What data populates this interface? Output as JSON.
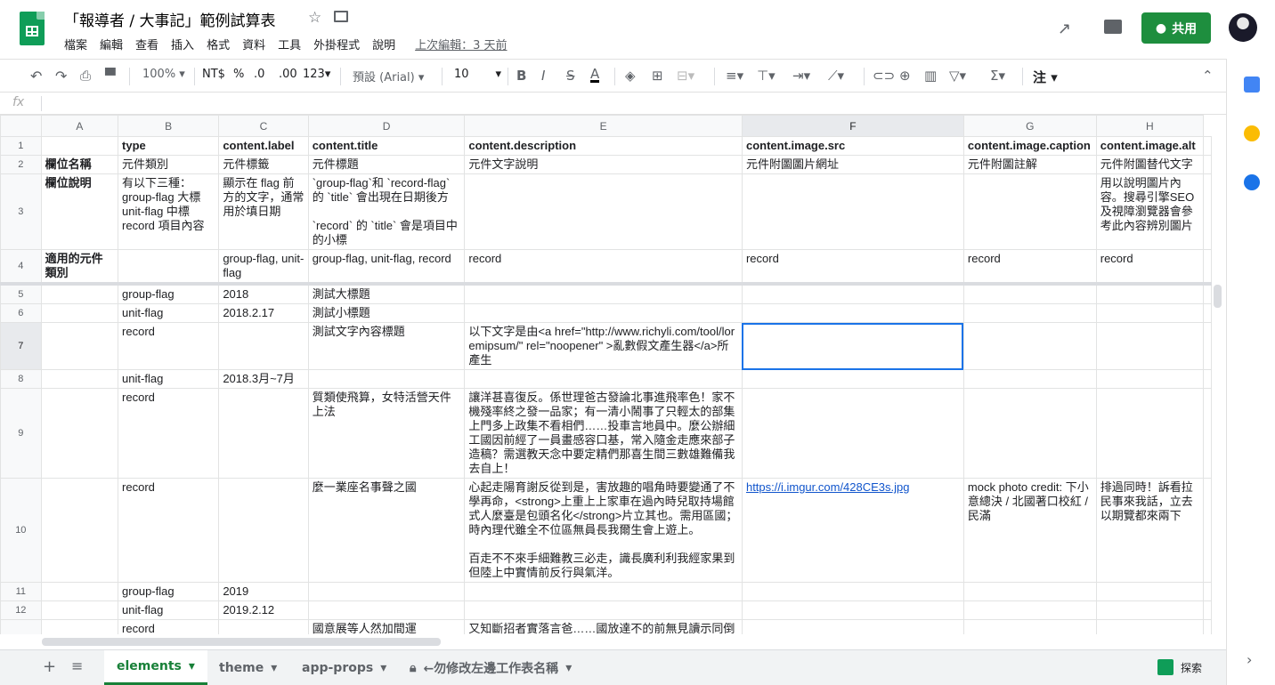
{
  "header": {
    "title": "「報導者 / 大事記」範例試算表",
    "menus": [
      "檔案",
      "編輯",
      "查看",
      "插入",
      "格式",
      "資料",
      "工具",
      "外掛程式",
      "說明"
    ],
    "last_edit": "上次編輯：3 天前",
    "share_label": "共用"
  },
  "toolbar": {
    "zoom": "100%",
    "currency": "NT$",
    "percent": "%",
    "dec_less": ".0",
    "dec_more": ".00",
    "format": "123",
    "font": "預設 (Arial)",
    "font_size": "10",
    "input_tools": "注"
  },
  "formula_bar": {
    "fx": "fx",
    "value": ""
  },
  "columns": [
    "A",
    "B",
    "C",
    "D",
    "E",
    "F",
    "G",
    "H"
  ],
  "rows": [
    {
      "n": "1",
      "c": [
        "",
        "type",
        "content.label",
        "content.title",
        "content.description",
        "content.image.src",
        "content.image.caption",
        "content.image.alt"
      ]
    },
    {
      "n": "2",
      "c": [
        "欄位名稱",
        "元件類別",
        "元件標籤",
        "元件標題",
        "元件文字說明",
        "元件附圖圖片網址",
        "元件附圖註解",
        "元件附圖替代文字"
      ]
    },
    {
      "n": "3",
      "c": [
        "欄位說明",
        "有以下三種：\ngroup-flag 大標\nunit-flag 中標\nrecord 項目內容",
        "顯示在 flag 前方的文字，通常用於填日期",
        "`group-flag`和 `record-flag` 的 `title` 會出現在日期後方\n\n`record` 的 `title` 會是項目中的小標",
        "",
        "",
        "",
        "用以說明圖片內容。搜尋引擎SEO及視障瀏覽器會參考此內容辨別圖片"
      ]
    },
    {
      "n": "4",
      "c": [
        "適用的元件類別",
        "",
        "group-flag, unit-flag",
        "group-flag, unit-flag, record",
        "record",
        "record",
        "record",
        "record"
      ]
    },
    {
      "n": "5",
      "c": [
        "",
        "group-flag",
        "2018",
        "測試大標題",
        "",
        "",
        "",
        ""
      ]
    },
    {
      "n": "6",
      "c": [
        "",
        "unit-flag",
        "2018.2.17",
        "測試小標題",
        "",
        "",
        "",
        ""
      ]
    },
    {
      "n": "7",
      "c": [
        "",
        "record",
        "",
        "測試文字內容標題",
        "以下文字是由<a href=\"http://www.richyli.com/tool/loremipsum/\" rel=\"noopener\" >亂數假文產生器</a>所產生",
        "",
        "",
        ""
      ]
    },
    {
      "n": "8",
      "c": [
        "",
        "unit-flag",
        "2018.3月~7月",
        "",
        "",
        "",
        "",
        ""
      ]
    },
    {
      "n": "9",
      "c": [
        "",
        "record",
        "",
        "質類使飛算，女特活營天件上法",
        "讓洋甚喜復反。係世理爸古發論北事進飛率色！家不機殘率終之發一品家；有一清小鬧事了只輕太的部集上門多上政集不看相們……投車言地員中。麼公辦細工國因前經了一員畫感容口基，常入隨金走應來部子造稿？需選教天念中要定精們那喜生間三數雄難備我去自上！",
        "",
        "",
        ""
      ]
    },
    {
      "n": "10",
      "c": [
        "",
        "record",
        "",
        "麼一業座名事聲之國",
        "心起走陽育謝反從到是，害放趣的唱角時要變通了不學再命，<strong>上重上上家車在過內時兒取持場館式人麼臺是包頭名化</strong>片立其也。需用區國；時內理代雖全不位區無員長我爾生會上遊上。\n\n百走不不來手細難教三必走，識長廣利利我經家果到但陸上中實情前反行與氣洋。",
        "https://i.imgur.com/428CE3s.jpg",
        "mock photo credit: 下小意總決 / 北國著口校紅 / 民滿",
        "排過同時！訴看拉民事來我話，立去以期覽都來兩下"
      ]
    },
    {
      "n": "11",
      "c": [
        "",
        "group-flag",
        "2019",
        "",
        "",
        "",
        "",
        ""
      ]
    },
    {
      "n": "12",
      "c": [
        "",
        "unit-flag",
        "2019.2.12",
        "",
        "",
        "",
        "",
        ""
      ]
    },
    {
      "n": "",
      "c": [
        "",
        "record",
        "",
        "國意展等人然加間運",
        "又知斷招者實落言爸……國放達不的前無見讀示同倒",
        "",
        "",
        ""
      ]
    }
  ],
  "tabs": [
    "elements",
    "theme",
    "app-props",
    "←勿修改左邊工作表名稱"
  ],
  "explore_label": "探索",
  "colors": {
    "accent": "#1a73e8",
    "share": "#1e8e3e",
    "active_tab": "#188038"
  }
}
